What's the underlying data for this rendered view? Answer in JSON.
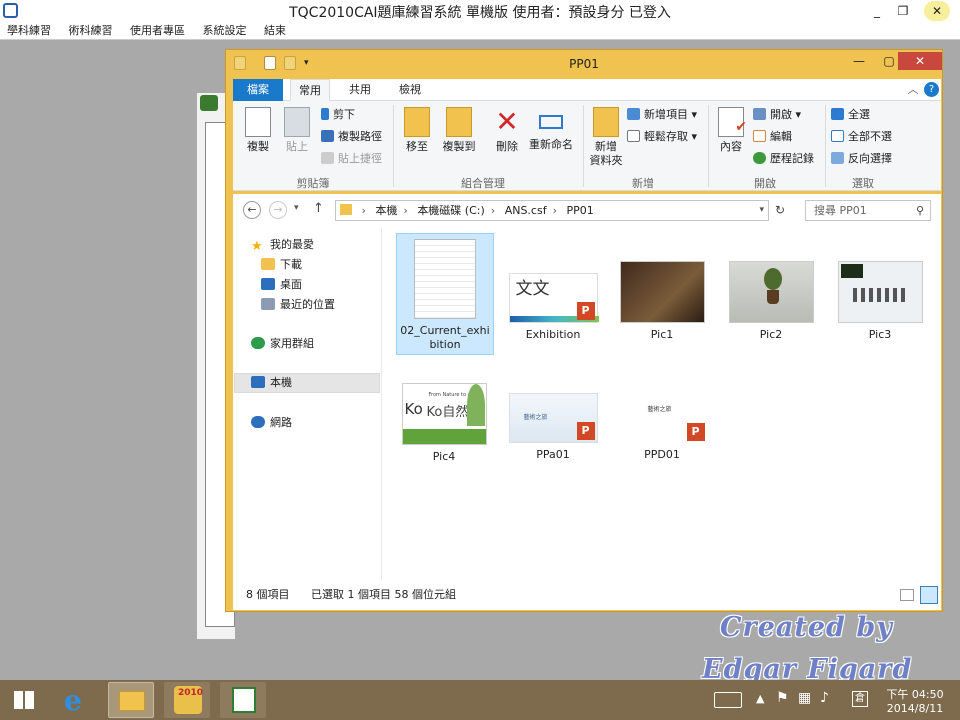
{
  "app": {
    "title": "TQC2010CAI題庫練習系統 單機版  使用者：預設身分 已登入",
    "minimize": "_",
    "maximize": "❐",
    "close": "✕"
  },
  "menubar": [
    "學科練習",
    "術科練習",
    "使用者專區",
    "系統設定",
    "結束"
  ],
  "explorer": {
    "title": "PP01",
    "tabs": [
      "檔案",
      "常用",
      "共用",
      "檢視"
    ],
    "ribbon": {
      "clipboard": {
        "label": "剪貼簿",
        "copy": "複製",
        "paste": "貼上",
        "cut": "剪下",
        "copy_path": "複製路徑",
        "paste_shortcut": "貼上捷徑"
      },
      "organize": {
        "label": "組合管理",
        "move_to": "移至",
        "copy_to": "複製到",
        "delete": "刪除",
        "rename": "重新命名"
      },
      "new": {
        "label": "新增",
        "new_folder_line1": "新增",
        "new_folder_line2": "資料夾",
        "new_item": "新增項目",
        "easy_access": "輕鬆存取"
      },
      "open": {
        "label": "開啟",
        "properties": "內容",
        "open": "開啟",
        "edit": "編輯",
        "history": "歷程記錄"
      },
      "select": {
        "label": "選取",
        "select_all": "全選",
        "select_none": "全部不選",
        "invert": "反向選擇"
      }
    },
    "address": {
      "path": [
        "本機",
        "本機磁碟 (C:)",
        "ANS.csf",
        "PP01"
      ],
      "search_placeholder": "搜尋 PP01"
    },
    "navpane": {
      "favorites": "我的最愛",
      "downloads": "下載",
      "desktop": "桌面",
      "recent": "最近的位置",
      "homegroup": "家用群組",
      "this_pc": "本機",
      "network": "網路"
    },
    "files": [
      {
        "name": "02_Current_exhi\nbition",
        "type": "text"
      },
      {
        "name": "Exhibition",
        "type": "pptx"
      },
      {
        "name": "Pic1",
        "type": "image"
      },
      {
        "name": "Pic2",
        "type": "image"
      },
      {
        "name": "Pic3",
        "type": "image"
      },
      {
        "name": "Pic4",
        "type": "image"
      },
      {
        "name": "PPa01",
        "type": "pptx"
      },
      {
        "name": "PPD01",
        "type": "pptx"
      }
    ],
    "thumb_text": {
      "exhibition": "文文",
      "pic4_big": "Ko",
      "pic4_title": "Ko自然",
      "pic4_sub": "From Nature to Art",
      "ppa01": "藝術之旅",
      "ppd01": "藝術之旅"
    },
    "status": {
      "count": "8 個項目",
      "selected": "已選取 1 個項目  58 個位元組"
    }
  },
  "taskbar": {
    "ie_glyph": "e",
    "app_badge": "2010",
    "time": "下午 04:50",
    "date": "2014/8/11"
  },
  "watermark": {
    "line1": "Created by",
    "line2": "Edgar Figard"
  },
  "colors": {
    "explorer_frame": "#f0c24f",
    "file_tab": "#1979ca",
    "selection": "#cce8ff",
    "close": "#c9483e",
    "taskbar": "#7e6a4c"
  }
}
